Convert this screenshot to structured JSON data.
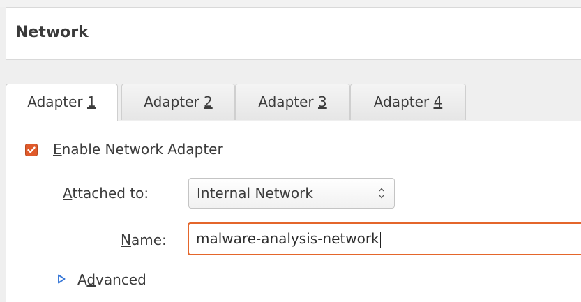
{
  "section": {
    "title": "Network"
  },
  "tabs": [
    {
      "prefix": "Adapter ",
      "mnemonic": "1",
      "active": true
    },
    {
      "prefix": "Adapter ",
      "mnemonic": "2",
      "active": false
    },
    {
      "prefix": "Adapter ",
      "mnemonic": "3",
      "active": false
    },
    {
      "prefix": "Adapter ",
      "mnemonic": "4",
      "active": false
    }
  ],
  "enable_adapter": {
    "mnemonic": "E",
    "rest": "nable Network Adapter",
    "checked": true
  },
  "attached_to": {
    "mnemonic": "A",
    "rest": "ttached to:",
    "value": "Internal Network"
  },
  "name": {
    "mnemonic": "N",
    "rest": "ame:",
    "value": "malware-analysis-network"
  },
  "advanced": {
    "prefix": "A",
    "mnemonic": "d",
    "rest": "vanced",
    "expanded": false
  },
  "colors": {
    "accent": "#e4662b",
    "expander": "#3b7ad8"
  },
  "icons": {
    "checkbox": "checkmark-icon",
    "spinner": "spin-arrows-icon",
    "expander": "triangle-right-icon"
  }
}
